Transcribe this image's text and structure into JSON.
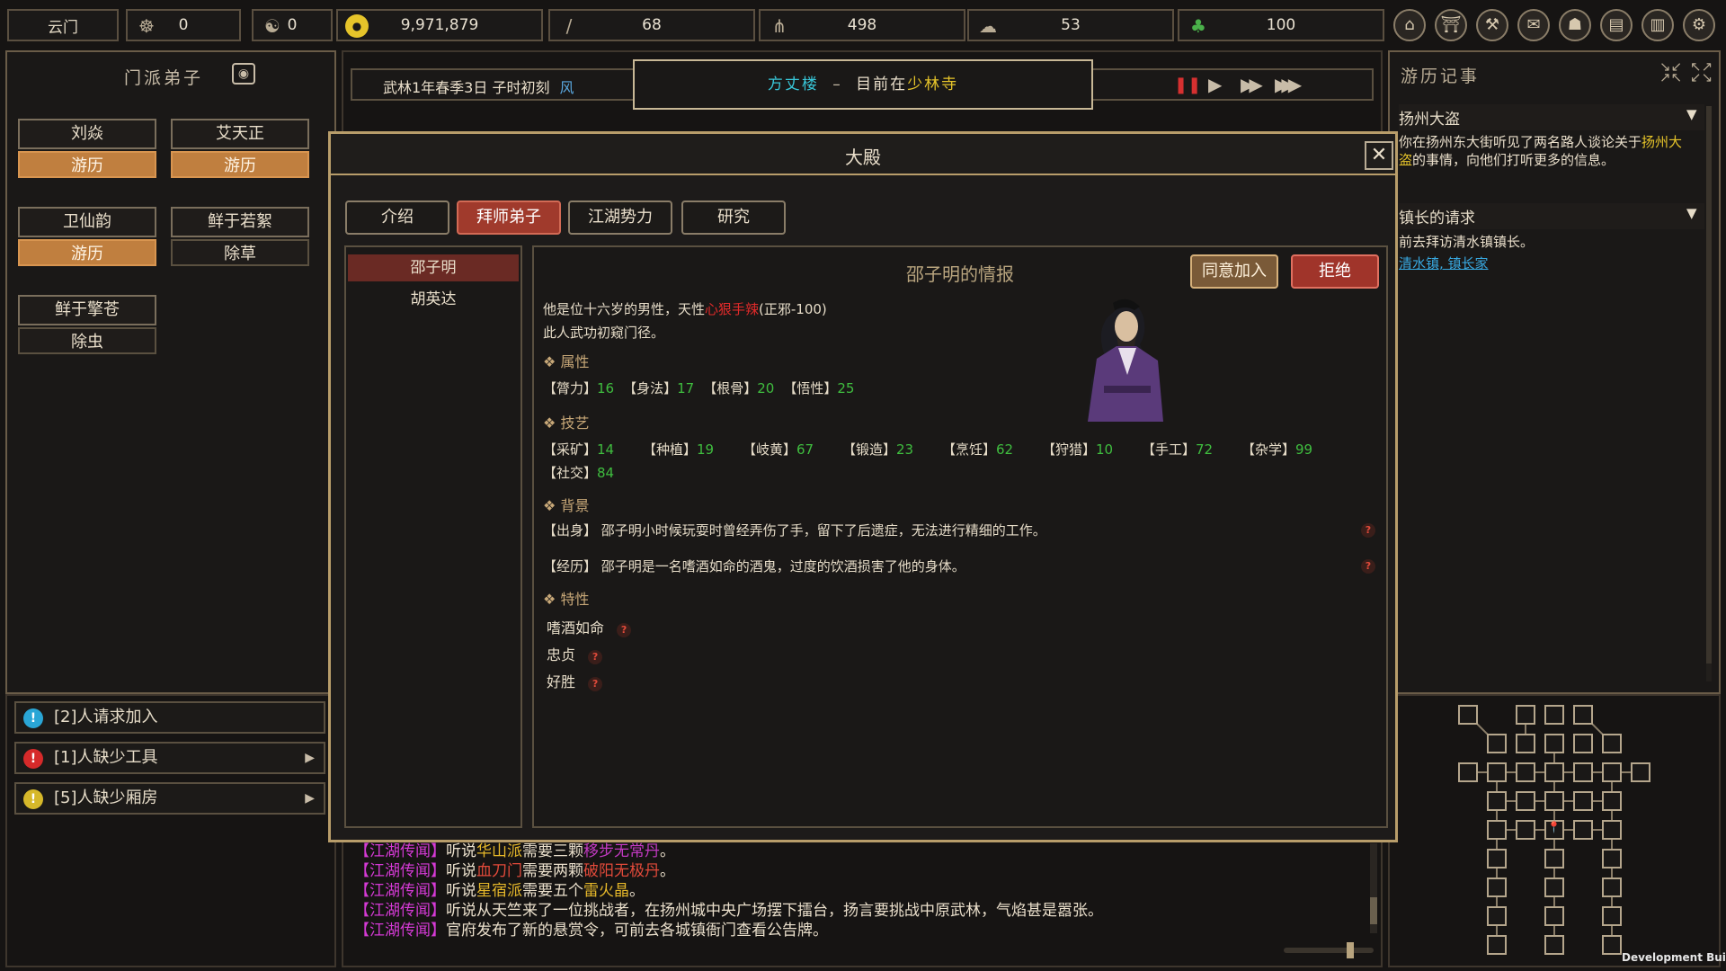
{
  "topbar": {
    "sect_name": "云门",
    "resources": [
      {
        "icon": "reputation-icon",
        "value": "0"
      },
      {
        "icon": "yinyang-icon",
        "value": "0"
      },
      {
        "icon": "coin-icon",
        "value": "9,971,879"
      },
      {
        "icon": "wood-icon",
        "value": "68"
      },
      {
        "icon": "grain-icon",
        "value": "498"
      },
      {
        "icon": "ore-icon",
        "value": "53"
      },
      {
        "icon": "herb-icon",
        "value": "100"
      }
    ],
    "menu_icons": [
      "building-icon",
      "gate-icon",
      "tools-icon",
      "scroll-icon",
      "bag-icon",
      "book-icon",
      "manual-icon",
      "settings-icon"
    ]
  },
  "left": {
    "title": "门派弟子",
    "disciples": [
      {
        "name": "刘焱",
        "status": "游历",
        "style": "orange"
      },
      {
        "name": "艾天正",
        "status": "游历",
        "style": "orange"
      },
      {
        "name": "卫仙韵",
        "status": "游历",
        "style": "orange"
      },
      {
        "name": "鲜于若絮",
        "status": "除草",
        "style": "dark"
      },
      {
        "name": "鲜于擎苍",
        "status": "除虫",
        "style": "dark"
      }
    ],
    "alerts": [
      {
        "text": "[2]人请求加入",
        "color": "#2aa6d6"
      },
      {
        "text": "[1]人缺少工具",
        "color": "#d62a2a"
      },
      {
        "text": "[5]人缺少厢房",
        "color": "#d6b82a"
      }
    ]
  },
  "timebar": {
    "date": "武林1年春季3日  子时初刻",
    "weather": "风",
    "location_building": "方丈楼",
    "location_sep": "–",
    "location_prefix": "目前在",
    "location_place": "少林寺"
  },
  "right": {
    "title": "游历记事",
    "events": [
      {
        "title": "扬州大盗",
        "body_pre": "你在扬州东大街听见了两名路人谈论关于",
        "body_hl": "扬州大盗",
        "body_post": "的事情，向他们打听更多的信息。"
      },
      {
        "title": "镇长的请求",
        "body": "前去拜访清水镇镇长。",
        "link": "清水镇, 镇长家"
      }
    ]
  },
  "dialog": {
    "title": "大殿",
    "tabs": [
      "介绍",
      "拜师弟子",
      "江湖势力",
      "研究"
    ],
    "active_tab": 1,
    "applicants": [
      "邵子明",
      "胡英达"
    ],
    "info_title": "邵子明的情报",
    "accept": "同意加入",
    "reject": "拒绝",
    "desc1_pre": "他是位十六岁的男性，天性",
    "desc1_trait": "心狠手辣",
    "desc1_post": "(正邪-100)",
    "desc2": "此人武功初窥门径。",
    "sec_attr": "属性",
    "attrs": [
      {
        "k": "【膂力】",
        "v": "16"
      },
      {
        "k": "【身法】",
        "v": "17"
      },
      {
        "k": "【根骨】",
        "v": "20"
      },
      {
        "k": "【悟性】",
        "v": "25"
      }
    ],
    "sec_skill": "技艺",
    "skills": [
      {
        "k": "【采矿】",
        "v": "14"
      },
      {
        "k": "【种植】",
        "v": "19"
      },
      {
        "k": "【岐黄】",
        "v": "67"
      },
      {
        "k": "【锻造】",
        "v": "23"
      },
      {
        "k": "【烹饪】",
        "v": "62"
      },
      {
        "k": "【狩猎】",
        "v": "10"
      },
      {
        "k": "【手工】",
        "v": "72"
      },
      {
        "k": "【杂学】",
        "v": "99"
      },
      {
        "k": "【社交】",
        "v": "84"
      }
    ],
    "sec_bg": "背景",
    "bg_origin": "【出身】 邵子明小时候玩耍时曾经弄伤了手，留下了后遗症，无法进行精细的工作。",
    "bg_exp": "【经历】 邵子明是一名嗜酒如命的酒鬼，过度的饮酒损害了他的身体。",
    "sec_trait": "特性",
    "traits": [
      "嗜酒如命",
      "忠贞",
      "好胜"
    ]
  },
  "news": [
    {
      "tag": "【江湖传闻】",
      "parts": [
        [
          "听说",
          ""
        ],
        [
          "华山派",
          "y"
        ],
        [
          "需要三颗",
          ""
        ],
        [
          "移步无常丹",
          "pk"
        ],
        [
          "。",
          ""
        ]
      ]
    },
    {
      "tag": "【江湖传闻】",
      "parts": [
        [
          "听说",
          ""
        ],
        [
          "血刀门",
          "r"
        ],
        [
          "需要两颗",
          ""
        ],
        [
          "破阳无极丹",
          "r"
        ],
        [
          "。",
          ""
        ]
      ]
    },
    {
      "tag": "【江湖传闻】",
      "parts": [
        [
          "听说",
          ""
        ],
        [
          "星宿派",
          "y"
        ],
        [
          "需要五个",
          ""
        ],
        [
          "雷火晶",
          "y"
        ],
        [
          "。",
          ""
        ]
      ]
    },
    {
      "tag": "【江湖传闻】",
      "parts": [
        [
          "听说从天竺来了一位挑战者，在扬州城中央广场摆下擂台，扬言要挑战中原武林，气焰甚是嚣张。",
          ""
        ]
      ]
    },
    {
      "tag": "【江湖传闻】",
      "parts": [
        [
          "官府发布了新的悬赏令，可前去各城镇衙门查看公告牌。",
          ""
        ]
      ]
    }
  ],
  "footer": "Development Build",
  "colors": {
    "accent_gold": "#b89d6a",
    "active_red": "#a03a2c",
    "green_value": "#3fbd3f",
    "trait_red": "#e02a2a"
  }
}
